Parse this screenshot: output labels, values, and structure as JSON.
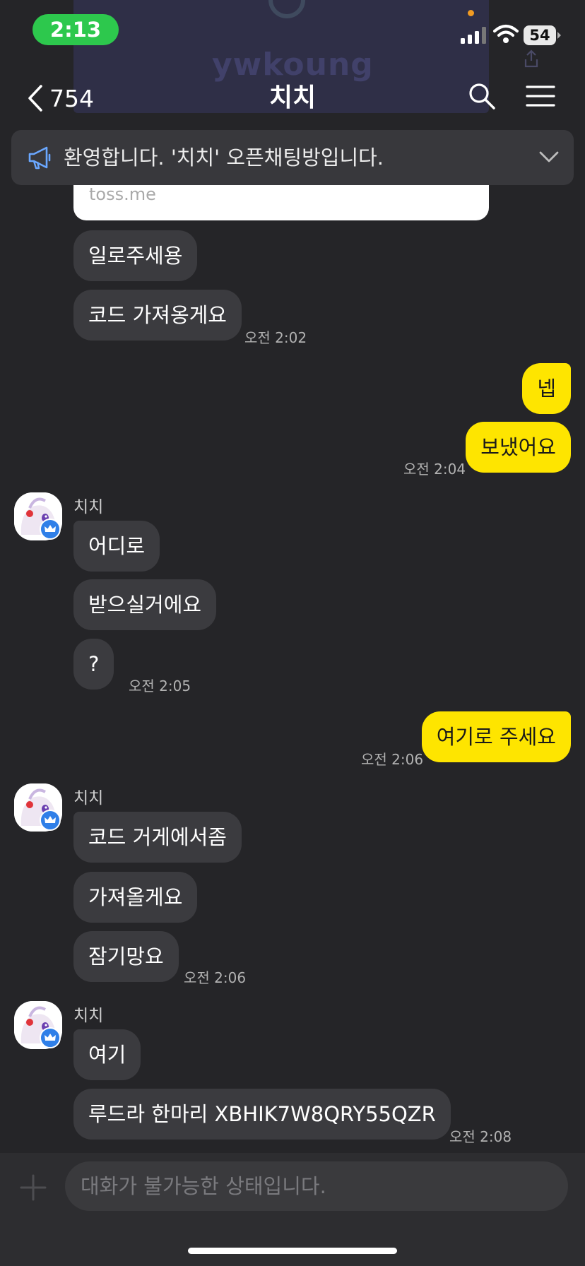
{
  "status": {
    "time": "2:13",
    "battery": "54"
  },
  "background_card": {
    "name": "ywkoung",
    "url": "toss.me"
  },
  "header": {
    "back_count": "754",
    "title": "치치"
  },
  "notice": {
    "text": "환영합니다. '치치' 오픈채팅방입니다."
  },
  "sender_name": "치치",
  "messages": [
    {
      "text": "일로주세용"
    },
    {
      "text": "코드 가져옹게요",
      "time": "오전 2:02"
    },
    {
      "text": "넵"
    },
    {
      "text": "보냈어요",
      "time": "오전 2:04"
    },
    {
      "text": "어디로"
    },
    {
      "text": "받으실거에요"
    },
    {
      "text": "?",
      "time": "오전 2:05"
    },
    {
      "text": "여기로 주세요",
      "time": "오전 2:06"
    },
    {
      "text": "코드 거게에서좀"
    },
    {
      "text": "가져올게요"
    },
    {
      "text": "잠기망요",
      "time": "오전 2:06"
    },
    {
      "text": "여기"
    },
    {
      "text": "루드라 한마리 XBHIK7W8QRY55QZR",
      "time": "오전 2:08"
    }
  ],
  "input": {
    "placeholder": "대화가 불가능한 상태입니다."
  },
  "colors": {
    "background": "#252528",
    "my_bubble": "#fee500",
    "other_bubble": "#3b3b3f",
    "notice": "#38383c"
  }
}
